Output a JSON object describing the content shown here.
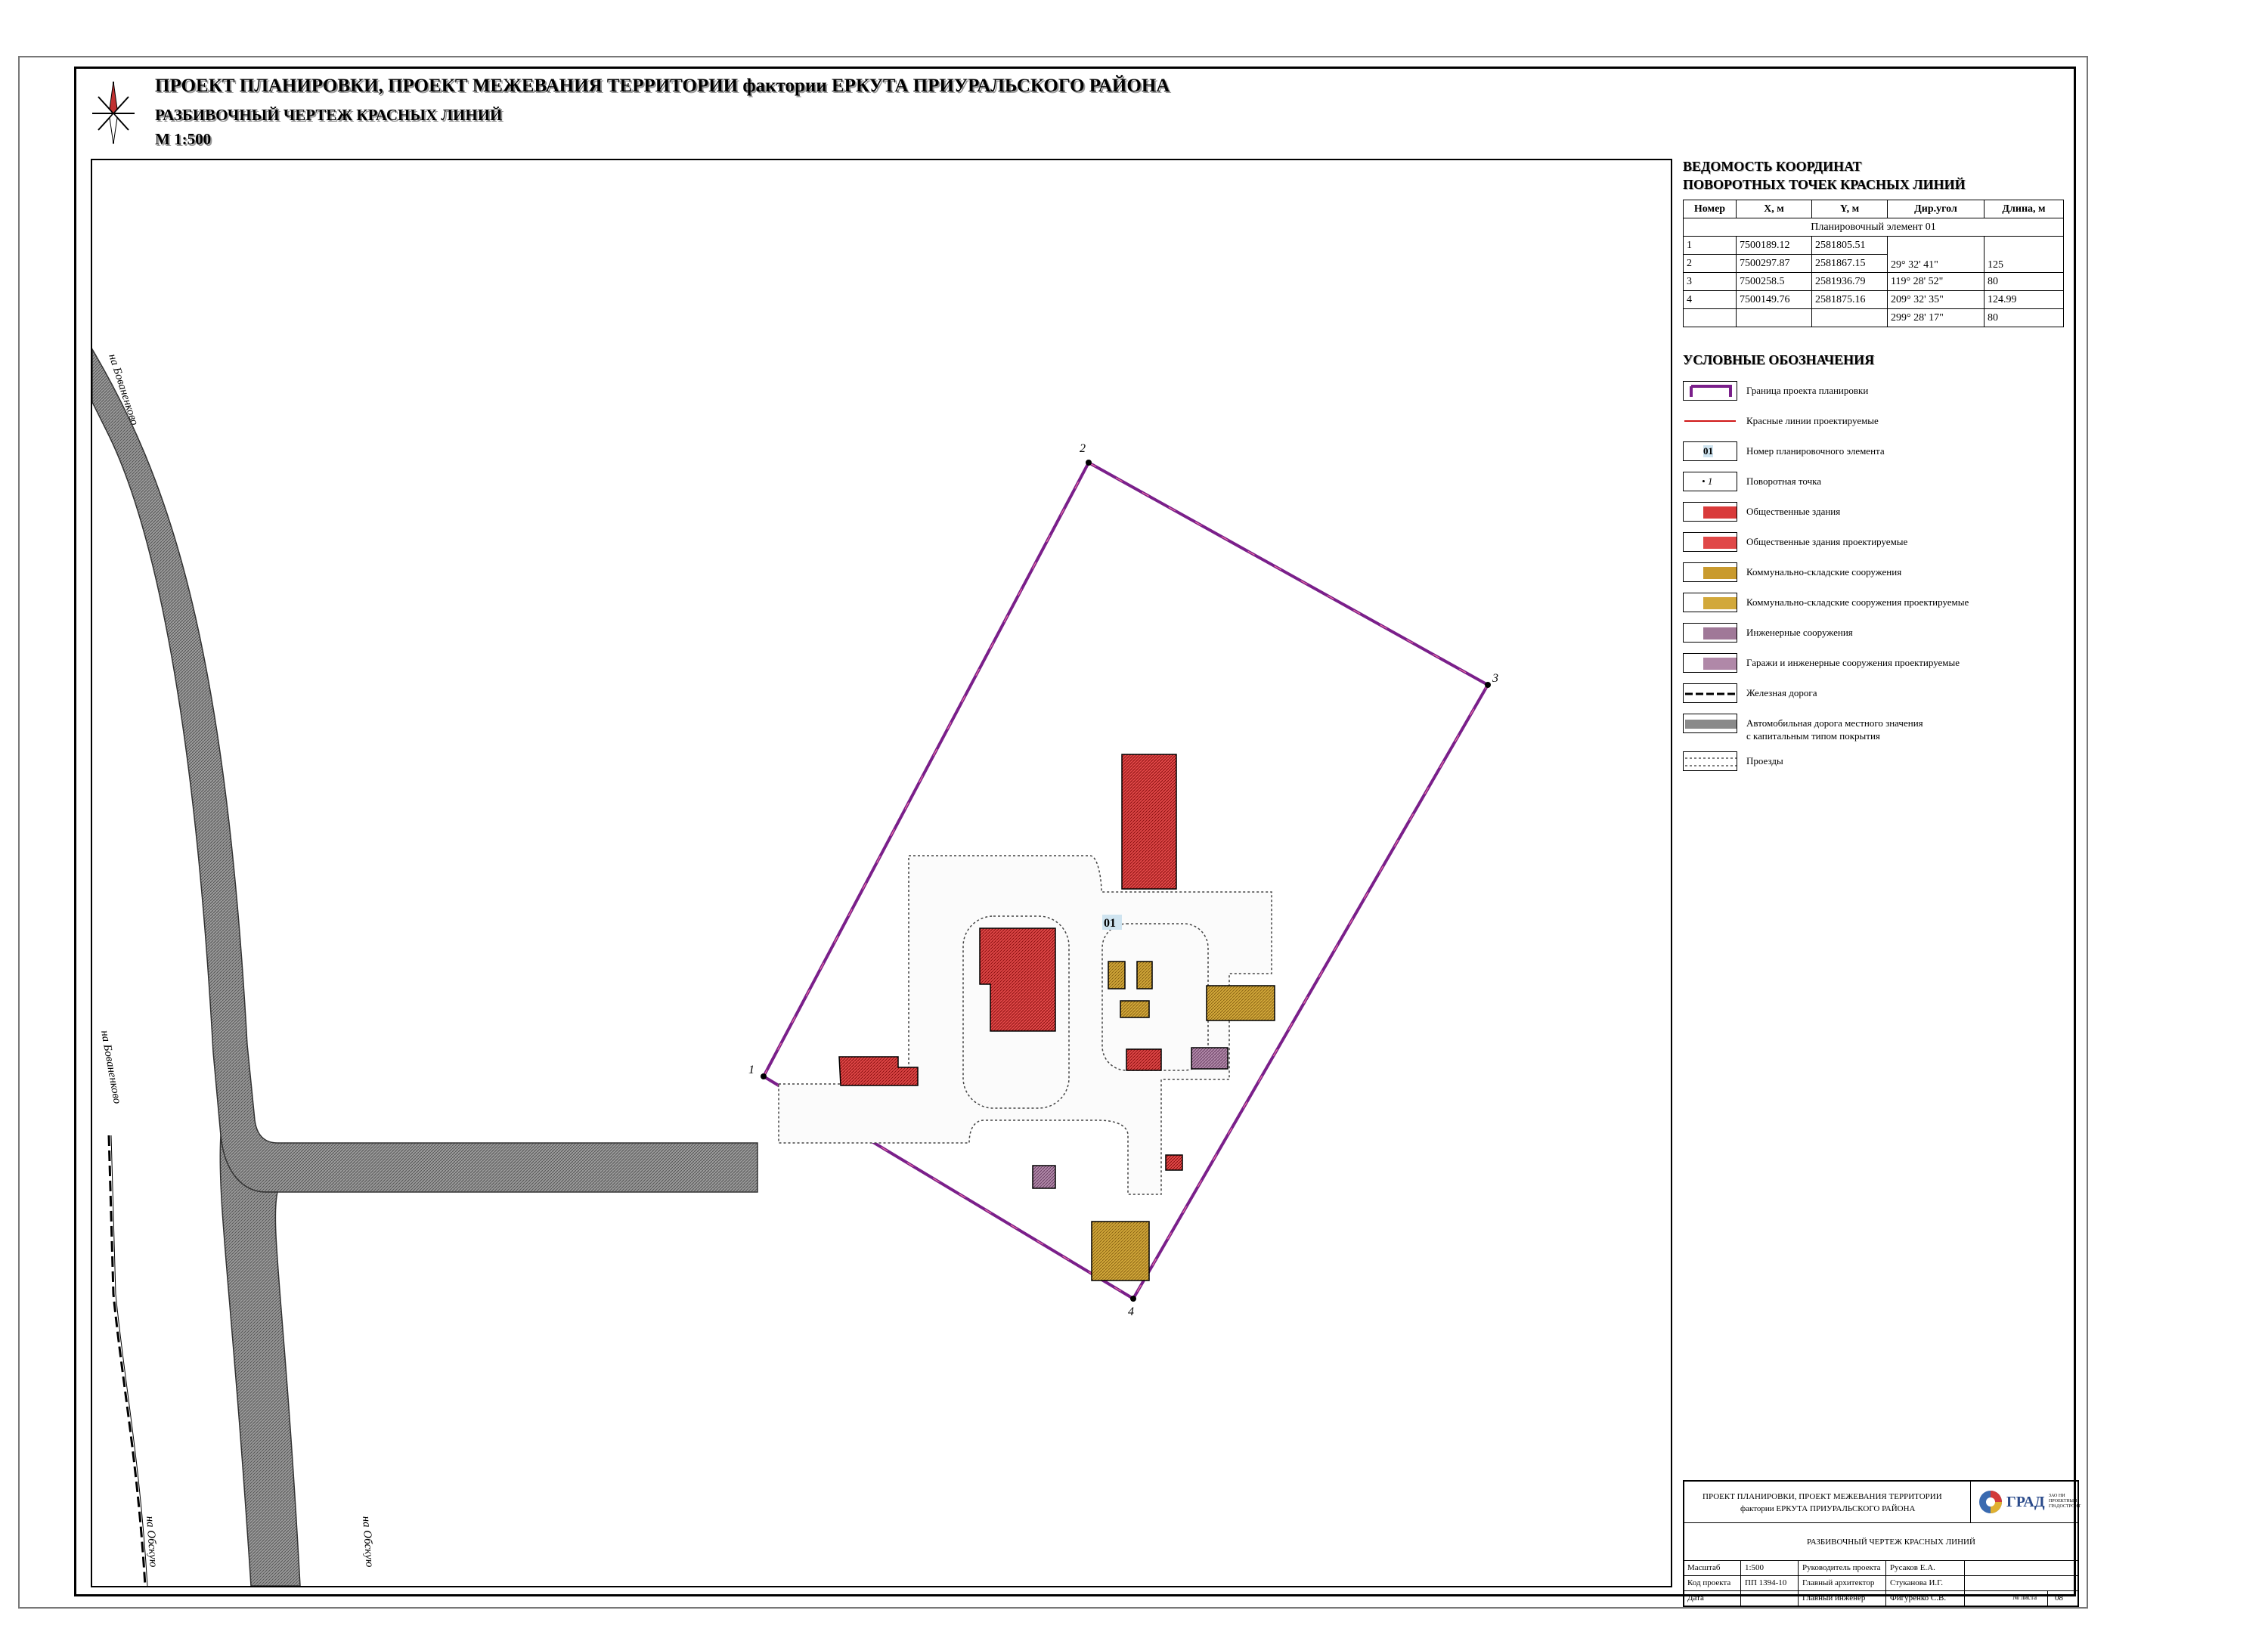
{
  "title": {
    "line1": "ПРОЕКТ ПЛАНИРОВКИ, ПРОЕКТ МЕЖЕВАНИЯ ТЕРРИТОРИИ фактории ЕРКУТА ПРИУРАЛЬСКОГО РАЙОНА",
    "line2": "РАЗБИВОЧНЫЙ ЧЕРТЕЖ КРАСНЫХ ЛИНИЙ",
    "line3": "М 1:500"
  },
  "coords": {
    "title_line1": "ВЕДОМОСТЬ КООРДИНАТ",
    "title_line2": "ПОВОРОТНЫХ ТОЧЕК КРАСНЫХ ЛИНИЙ",
    "headers": [
      "Номер",
      "X, м",
      "Y, м",
      "Дир.угол",
      "Длина, м"
    ],
    "element_label": "Планировочный элемент 01",
    "rows": [
      {
        "n": "1",
        "x": "7500189.12",
        "y": "2581805.51"
      },
      {
        "n": "2",
        "x": "7500297.87",
        "y": "2581867.15"
      },
      {
        "n": "3",
        "x": "7500258.5",
        "y": "2581936.79"
      },
      {
        "n": "4",
        "x": "7500149.76",
        "y": "2581875.16"
      }
    ],
    "segments": [
      {
        "angle": "29° 32' 41\"",
        "length": "125"
      },
      {
        "angle": "119° 28' 52\"",
        "length": "80"
      },
      {
        "angle": "209° 32' 35\"",
        "length": "124.99"
      },
      {
        "angle": "299° 28' 17\"",
        "length": "80"
      }
    ]
  },
  "legend": {
    "title": "УСЛОВНЫЕ ОБОЗНАЧЕНИЯ",
    "items": [
      "Граница проекта планировки",
      "Красные линии проектируемые",
      "Номер планировочного элемента",
      "Поворотная точка",
      "Общественные здания",
      "Общественные здания проектируемые",
      "Коммунально-складские сооружения",
      "Коммунально-складские сооружения проектируемые",
      "Инженерные сооружения",
      "Гаражи и инженерные сооружения проектируемые",
      "Железная дорога",
      "Автомобильная дорога местного значения",
      "Проезды"
    ],
    "item_extra": "с капитальным типом покрытия",
    "symbol_element_number": "01",
    "symbol_point_number": "1"
  },
  "map": {
    "points": [
      "1",
      "2",
      "3",
      "4"
    ],
    "element_number": "01",
    "road_labels": [
      "на Бованенково",
      "на Бованенково",
      "на Обскую",
      "на Обскую"
    ]
  },
  "colors": {
    "boundary": "#7a1f8a",
    "red_line": "#d01818",
    "public": "#d93a3a",
    "communal": "#c99a2e",
    "engineering": "#a07898",
    "road": "#8a8a8a"
  },
  "stamp": {
    "project_line1": "ПРОЕКТ ПЛАНИРОВКИ, ПРОЕКТ МЕЖЕВАНИЯ ТЕРРИТОРИИ",
    "project_line2": "фактории ЕРКУТА ПРИУРАЛЬСКОГО РАЙОНА",
    "sheet_title": "РАЗБИВОЧНЫЙ ЧЕРТЕЖ КРАСНЫХ ЛИНИЙ",
    "logo_text": "ГРАД",
    "logo_sub": "ЗАО НИ ПРОЕКТНЫЙ ГРАДОСТРОИТ",
    "row1": [
      "Масштаб",
      "1:500",
      "Руководитель проекта",
      "Русаков Е.А."
    ],
    "row2": [
      "Код проекта",
      "ПП 1394-10",
      "Главный архитектор",
      "Стуканова И.Г."
    ],
    "row3": [
      "Дата",
      "",
      "Главный инженер",
      "Фигуренко С.В."
    ],
    "sheet_label": "№ листа",
    "sheet_no": "08"
  }
}
